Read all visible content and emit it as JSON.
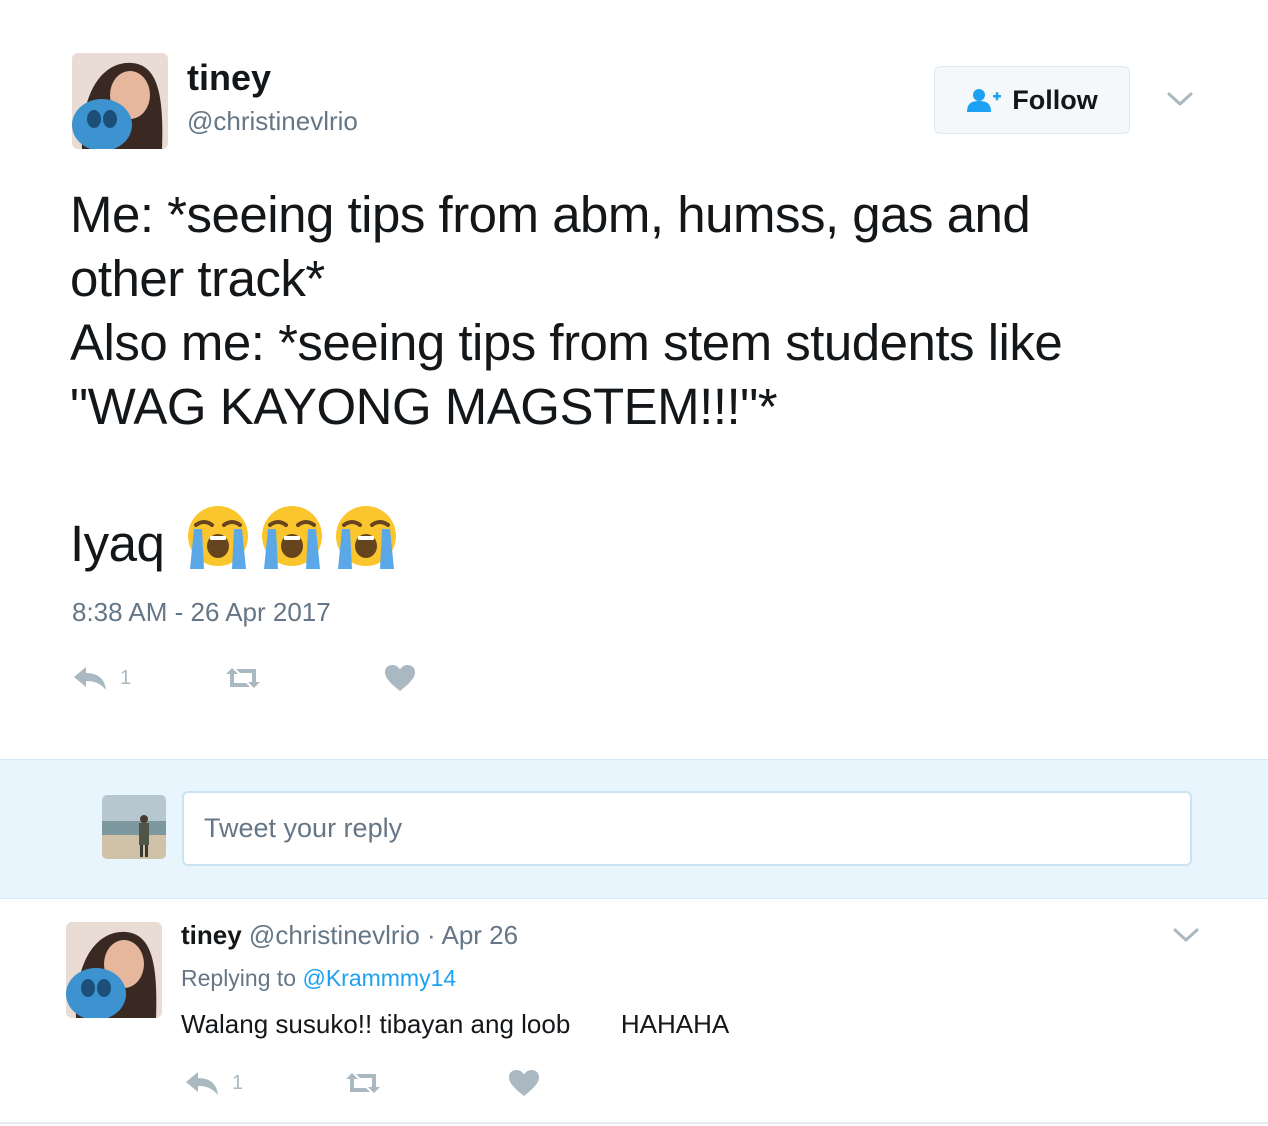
{
  "tweet": {
    "author_name": "tiney",
    "author_handle": "@christinevlrio",
    "follow_label": "Follow",
    "text_lines": [
      "Me: *seeing tips from abm, humss, gas and",
      "other track*",
      "Also me: *seeing tips from stem students like",
      "\"WAG KAYONG MAGSTEM!!!\"*",
      "",
      "Iyaq"
    ],
    "emoji_name": "loudly-crying-face",
    "emoji_count": 3,
    "timestamp": "8:38 AM - 26 Apr 2017",
    "reply_count": "1",
    "icons": [
      "reply-icon",
      "retweet-icon",
      "heart-icon",
      "chevron-down-icon",
      "follow-person-icon"
    ]
  },
  "reply_box": {
    "placeholder": "Tweet your reply"
  },
  "reply_tweet": {
    "author_name": "tiney",
    "author_handle": "@christinevlrio",
    "date": "· Apr 26",
    "replying_prefix": "Replying to",
    "replying_to": "@Krammmy14",
    "text": "Walang susuko!! tibayan ang loob       HAHAHA",
    "reply_count": "1"
  },
  "colors": {
    "text": "#14171a",
    "secondary": "#657786",
    "accent": "#1da1f2",
    "icon_gray": "#aab8c2",
    "reply_band": "#e8f5fd"
  }
}
